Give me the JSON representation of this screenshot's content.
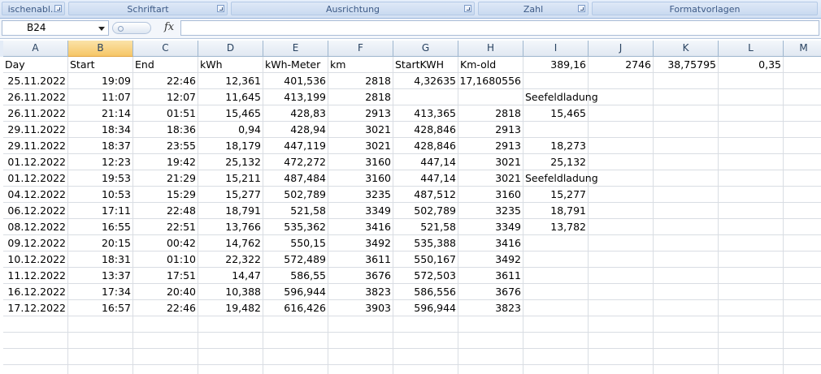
{
  "ribbon": {
    "groups": [
      {
        "label": "ischenabl...",
        "has_launcher": true
      },
      {
        "label": "Schriftart",
        "has_launcher": true
      },
      {
        "label": "Ausrichtung",
        "has_launcher": true
      },
      {
        "label": "Zahl",
        "has_launcher": true
      },
      {
        "label": "Formatvorlagen",
        "has_launcher": false
      }
    ]
  },
  "formula_bar": {
    "name_box": "B24",
    "fx_label": "fx",
    "formula": ""
  },
  "columns": [
    "A",
    "B",
    "C",
    "D",
    "E",
    "F",
    "G",
    "H",
    "I",
    "J",
    "K",
    "L",
    "M"
  ],
  "selected_column": "B",
  "rows": [
    [
      "Day",
      "Start",
      "End",
      "kWh",
      "kWh-Meter",
      "km",
      "StartKWH",
      "Km-old",
      "389,16",
      "2746",
      "38,75795",
      "0,35",
      ""
    ],
    [
      "25.11.2022",
      "19:09",
      "22:46",
      "12,361",
      "401,536",
      "2818",
      "4,32635",
      "17,1680556",
      "",
      "",
      "",
      "",
      ""
    ],
    [
      "26.11.2022",
      "11:07",
      "12:07",
      "11,645",
      "413,199",
      "2818",
      "",
      "",
      "Seefeldladung",
      "",
      "",
      "",
      ""
    ],
    [
      "26.11.2022",
      "21:14",
      "01:51",
      "15,465",
      "428,83",
      "2913",
      "413,365",
      "2818",
      "15,465",
      "",
      "",
      "",
      ""
    ],
    [
      "29.11.2022",
      "18:34",
      "18:36",
      "0,94",
      "428,94",
      "3021",
      "428,846",
      "2913",
      "",
      "",
      "",
      "",
      ""
    ],
    [
      "29.11.2022",
      "18:37",
      "23:55",
      "18,179",
      "447,119",
      "3021",
      "428,846",
      "2913",
      "18,273",
      "",
      "",
      "",
      ""
    ],
    [
      "01.12.2022",
      "12:23",
      "19:42",
      "25,132",
      "472,272",
      "3160",
      "447,14",
      "3021",
      "25,132",
      "",
      "",
      "",
      ""
    ],
    [
      "01.12.2022",
      "19:53",
      "21:29",
      "15,211",
      "487,484",
      "3160",
      "447,14",
      "3021",
      "Seefeldladung",
      "",
      "",
      "",
      ""
    ],
    [
      "04.12.2022",
      "10:53",
      "15:29",
      "15,277",
      "502,789",
      "3235",
      "487,512",
      "3160",
      "15,277",
      "",
      "",
      "",
      ""
    ],
    [
      "06.12.2022",
      "17:11",
      "22:48",
      "18,791",
      "521,58",
      "3349",
      "502,789",
      "3235",
      "18,791",
      "",
      "",
      "",
      ""
    ],
    [
      "08.12.2022",
      "16:55",
      "22:51",
      "13,766",
      "535,362",
      "3416",
      "521,58",
      "3349",
      "13,782",
      "",
      "",
      "",
      ""
    ],
    [
      "09.12.2022",
      "20:15",
      "00:42",
      "14,762",
      "550,15",
      "3492",
      "535,388",
      "3416",
      "",
      "",
      "",
      "",
      ""
    ],
    [
      "10.12.2022",
      "18:31",
      "01:10",
      "22,322",
      "572,489",
      "3611",
      "550,167",
      "3492",
      "",
      "",
      "",
      "",
      ""
    ],
    [
      "11.12.2022",
      "13:37",
      "17:51",
      "14,47",
      "586,55",
      "3676",
      "572,503",
      "3611",
      "",
      "",
      "",
      "",
      ""
    ],
    [
      "16.12.2022",
      "17:34",
      "20:40",
      "10,388",
      "596,944",
      "3823",
      "586,556",
      "3676",
      "",
      "",
      "",
      "",
      ""
    ],
    [
      "17.12.2022",
      "16:57",
      "22:46",
      "19,482",
      "616,426",
      "3903",
      "596,944",
      "3823",
      "",
      "",
      "",
      "",
      ""
    ]
  ],
  "colors": {
    "ribbon_bg": "#d4e1f3",
    "selected_header": "#f6c667",
    "gridline": "#d9dde3"
  }
}
